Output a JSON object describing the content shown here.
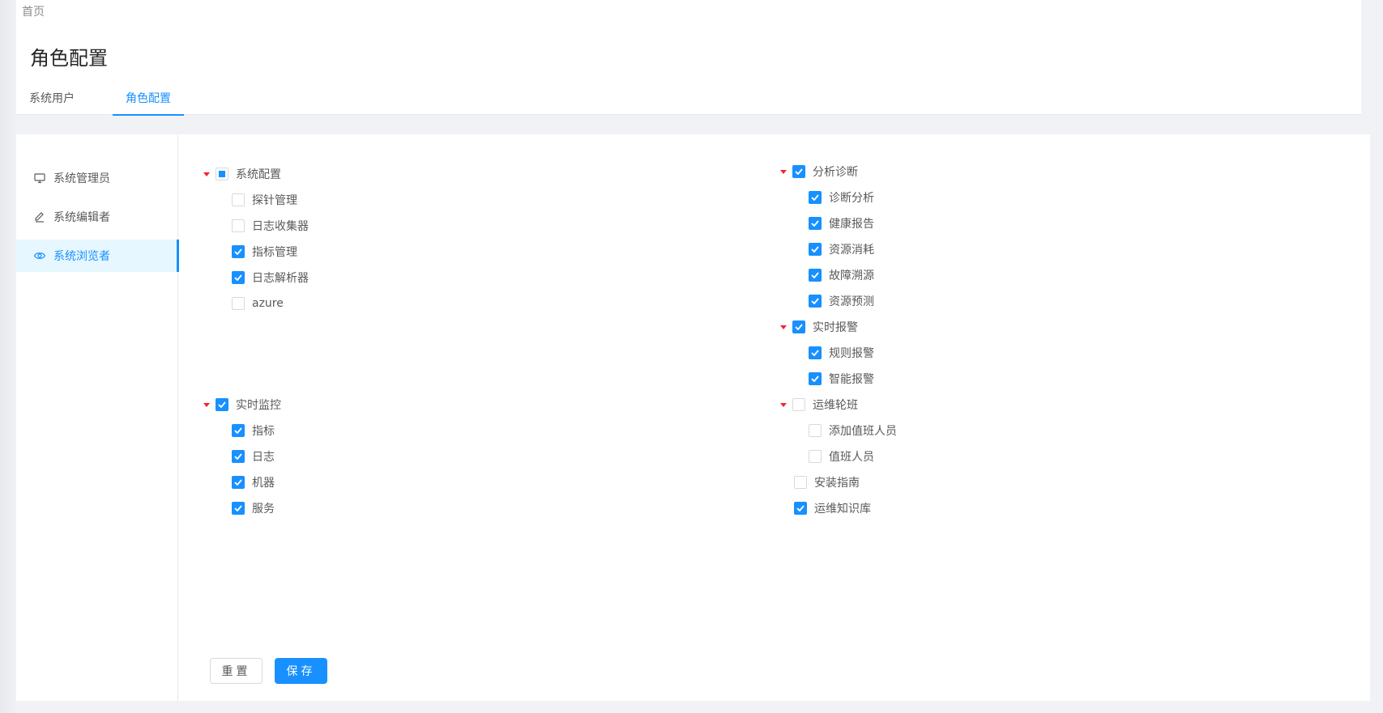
{
  "breadcrumb": "首页",
  "page_title": "角色配置",
  "tabs": [
    {
      "label": "系统用户"
    },
    {
      "label": "角色配置"
    }
  ],
  "sidebar": {
    "items": [
      {
        "label": "系统管理员",
        "icon": "monitor-icon"
      },
      {
        "label": "系统编辑者",
        "icon": "edit-icon"
      },
      {
        "label": "系统浏览者",
        "icon": "eye-icon",
        "active": true
      }
    ]
  },
  "tree_left": {
    "sys_config": {
      "label": "系统配置",
      "state": "indeterminate",
      "children": [
        {
          "label": "探针管理",
          "checked": false
        },
        {
          "label": "日志收集器",
          "checked": false
        },
        {
          "label": "指标管理",
          "checked": true
        },
        {
          "label": "日志解析器",
          "checked": true
        },
        {
          "label": "azure",
          "checked": false
        }
      ]
    },
    "realtime_monitor": {
      "label": "实时监控",
      "state": "checked",
      "children": [
        {
          "label": "指标",
          "checked": true
        },
        {
          "label": "日志",
          "checked": true
        },
        {
          "label": "机器",
          "checked": true
        },
        {
          "label": "服务",
          "checked": true
        }
      ]
    }
  },
  "tree_right": {
    "analysis": {
      "label": "分析诊断",
      "state": "checked",
      "children": [
        {
          "label": "诊断分析",
          "checked": true
        },
        {
          "label": "健康报告",
          "checked": true
        },
        {
          "label": "资源消耗",
          "checked": true
        },
        {
          "label": "故障溯源",
          "checked": true
        },
        {
          "label": "资源预测",
          "checked": true
        }
      ]
    },
    "alerts": {
      "label": "实时报警",
      "state": "checked",
      "children": [
        {
          "label": "规则报警",
          "checked": true
        },
        {
          "label": "智能报警",
          "checked": true
        }
      ]
    },
    "oncall": {
      "label": "运维轮班",
      "state": "unchecked",
      "children": [
        {
          "label": "添加值班人员",
          "checked": false
        },
        {
          "label": "值班人员",
          "checked": false
        }
      ]
    },
    "install_guide": {
      "label": "安装指南",
      "checked": false
    },
    "knowledge_base": {
      "label": "运维知识库",
      "checked": true
    }
  },
  "buttons": {
    "reset_label": "重置",
    "save_label": "保存"
  },
  "colors": {
    "primary": "#1890ff",
    "caret": "#f5222d"
  }
}
